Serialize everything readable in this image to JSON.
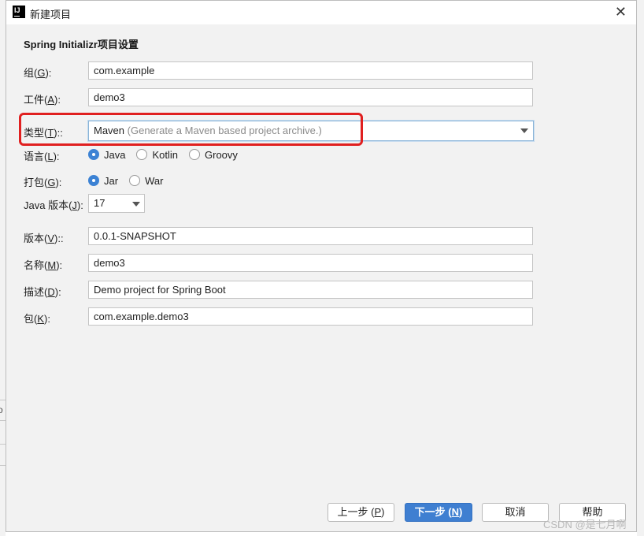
{
  "window": {
    "title": "新建项目",
    "app_icon": "intellij-icon",
    "close_glyph": "✕"
  },
  "section_title": "Spring Initializr项目设置",
  "fields": {
    "group": {
      "label_prefix": "组(",
      "mnemonic": "G",
      "label_suffix": "):",
      "value": "com.example"
    },
    "artifact": {
      "label_prefix": "工件(",
      "mnemonic": "A",
      "label_suffix": "):",
      "value": "demo3"
    },
    "type": {
      "label_prefix": "类型(",
      "mnemonic": "T",
      "label_suffix": ")::",
      "value": "Maven",
      "hint": "(Generate a Maven based project archive.)"
    },
    "language": {
      "label_prefix": "语言(",
      "mnemonic": "L",
      "label_suffix": "):",
      "options": [
        "Java",
        "Kotlin",
        "Groovy"
      ],
      "selected": "Java"
    },
    "packaging": {
      "label_prefix": "打包(",
      "mnemonic": "G",
      "label_suffix": "):",
      "options": [
        "Jar",
        "War"
      ],
      "selected": "Jar"
    },
    "java_version": {
      "label_prefix": "Java 版本(",
      "mnemonic": "J",
      "label_suffix": "):",
      "value": "17"
    },
    "version": {
      "label_prefix": "版本(",
      "mnemonic": "V",
      "label_suffix": ")::",
      "value": "0.0.1-SNAPSHOT"
    },
    "name": {
      "label_prefix": "名称(",
      "mnemonic": "M",
      "label_suffix": "):",
      "value": "demo3"
    },
    "description": {
      "label_prefix": "描述(",
      "mnemonic": "D",
      "label_suffix": "):",
      "value": "Demo project for Spring Boot"
    },
    "package": {
      "label_prefix": "包(",
      "mnemonic": "K",
      "label_suffix": "):",
      "value": "com.example.demo3"
    }
  },
  "buttons": {
    "previous": {
      "prefix": "上一步 (",
      "mnemonic": "P",
      "suffix": ")"
    },
    "next": {
      "prefix": "下一步 (",
      "mnemonic": "N",
      "suffix": ")"
    },
    "cancel": {
      "label": "取消"
    },
    "help": {
      "label": "帮助"
    }
  },
  "highlight_color": "#e02020",
  "accent_color": "#3f7fd1",
  "watermark": "CSDN @是七月啊",
  "backdrop_fragment": "o"
}
